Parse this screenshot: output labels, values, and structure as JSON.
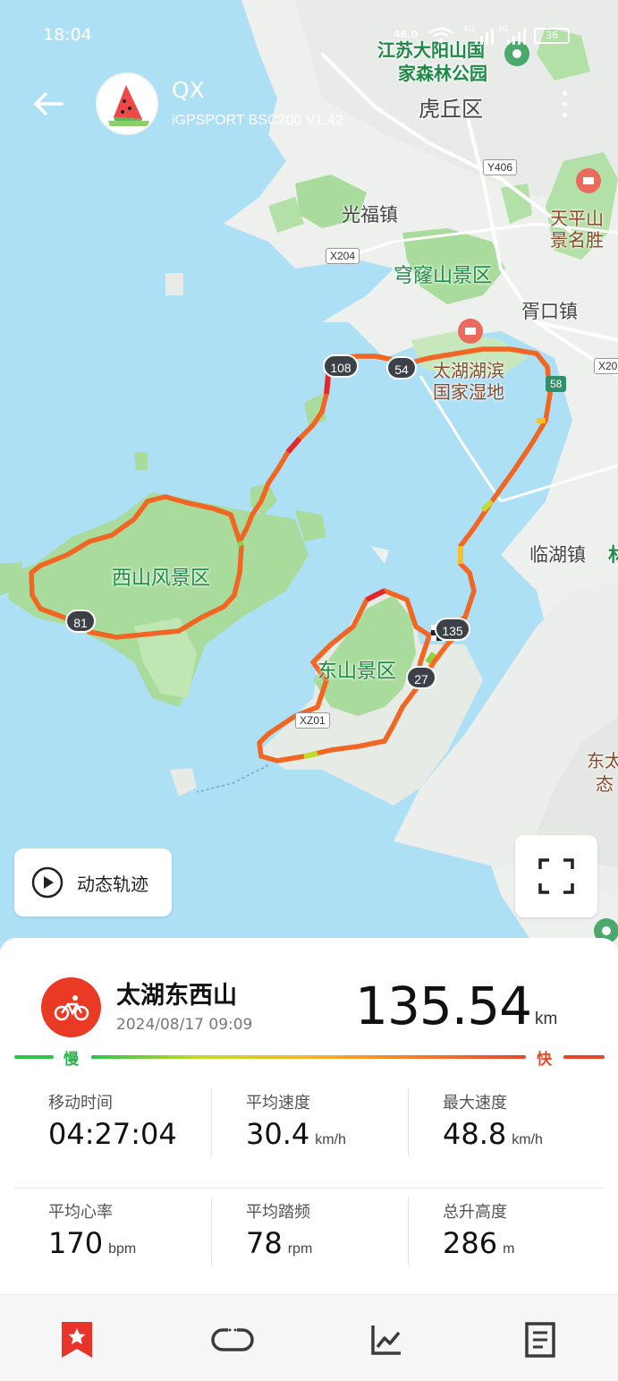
{
  "status_bar": {
    "time": "18:04",
    "network_speed": "46.0",
    "lte_1": "4G",
    "lte_2": "4G",
    "battery": "36"
  },
  "header": {
    "username": "QX",
    "device": "iGPSPORT BSC200  V1.42"
  },
  "map": {
    "labels": {
      "park_line1": "江苏大阳山国",
      "park_line2": "家森林公园",
      "huqiu": "虎丘区",
      "guangfu": "光福镇",
      "qionglong": "穹窿山景区",
      "xukou": "胥口镇",
      "tianping_line1": "天平山",
      "tianping_line2": "景名胜",
      "wetland_line1": "太湖湖滨",
      "wetland_line2": "国家湿地",
      "linhu": "临湖镇",
      "xishan": "西山风景区",
      "dongshan": "东山景区",
      "dongtai_line1": "东太",
      "dongtai_line2": "态",
      "edge_char": "林"
    },
    "road_tags": {
      "y406": "Y406",
      "x204": "X204",
      "x20": "X20",
      "r58": "58",
      "xz01": "XZ01"
    },
    "km_markers": [
      "108",
      "54",
      "81",
      "135",
      "27"
    ]
  },
  "replay_button": {
    "label": "动态轨迹"
  },
  "activity": {
    "title": "太湖东西山",
    "datetime": "2024/08/17 09:09",
    "distance": "135.54",
    "distance_unit": "km"
  },
  "speed_legend": {
    "slow": "慢",
    "fast": "快"
  },
  "stats": {
    "moving_time": {
      "label": "移动时间",
      "value": "04:27:04"
    },
    "avg_speed": {
      "label": "平均速度",
      "value": "30.4",
      "unit": "km/h"
    },
    "max_speed": {
      "label": "最大速度",
      "value": "48.8",
      "unit": "km/h"
    },
    "avg_hr": {
      "label": "平均心率",
      "value": "170",
      "unit": "bpm"
    },
    "avg_cadence": {
      "label": "平均踏频",
      "value": "78",
      "unit": "rpm"
    },
    "total_ascent": {
      "label": "总升高度",
      "value": "286",
      "unit": "m"
    }
  },
  "colors": {
    "accent": "#ea3a25",
    "slow": "#2bc44a",
    "fast": "#e8452a",
    "water": "#aee0f5",
    "park": "#a8dc9a"
  },
  "nav": {
    "tabs": [
      "star-tab",
      "track-tab",
      "chart-tab",
      "details-tab"
    ],
    "active": "star-tab"
  }
}
